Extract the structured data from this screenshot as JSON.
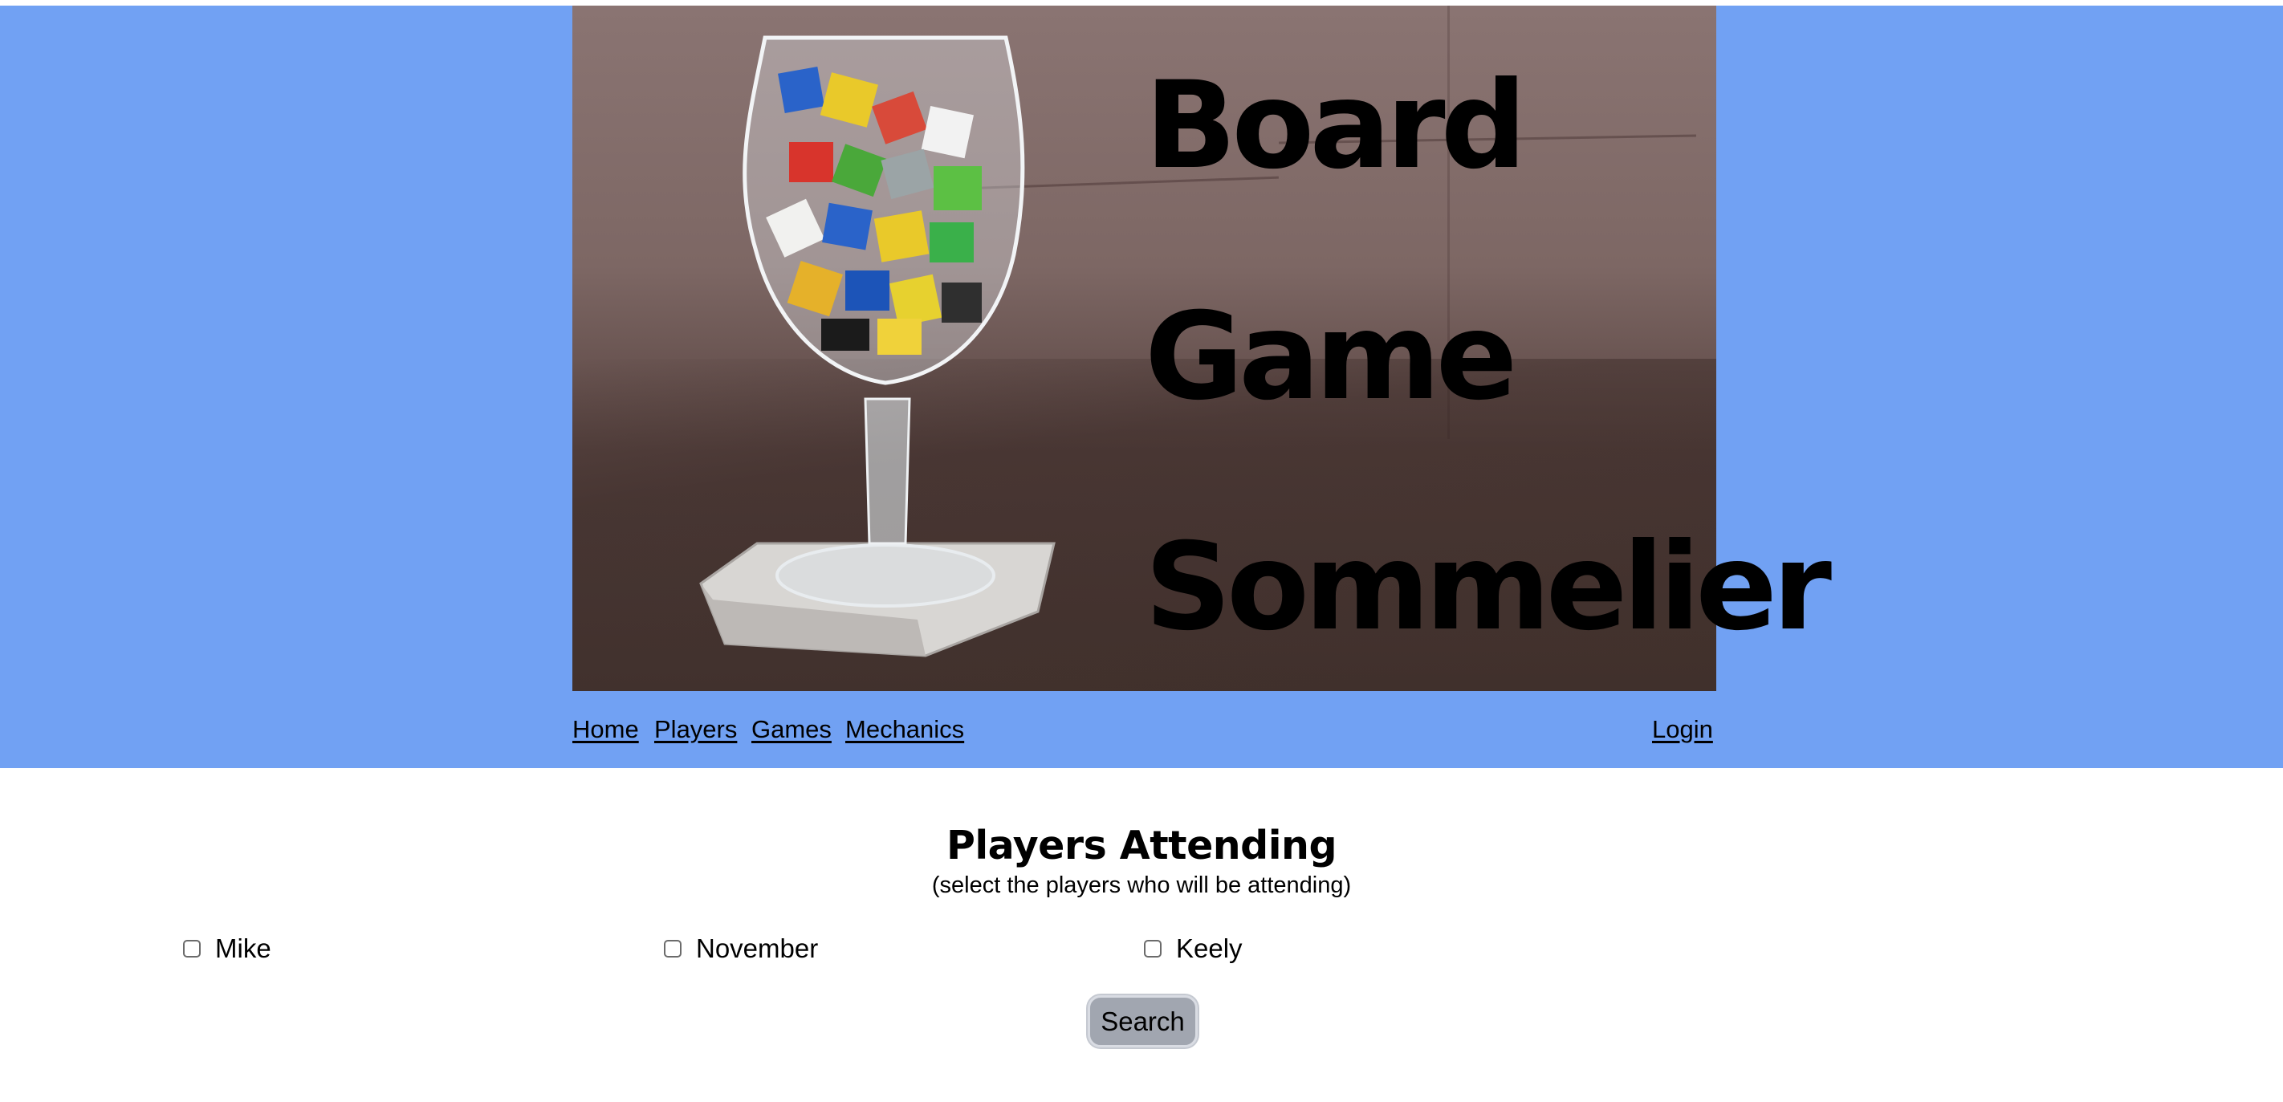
{
  "hero": {
    "title_lines": [
      "Board",
      "Game",
      "Sommelier"
    ]
  },
  "nav": {
    "links": [
      "Home",
      "Players",
      "Games",
      "Mechanics"
    ],
    "login": "Login"
  },
  "main": {
    "title": "Players Attending",
    "subtitle": "(select the players who will be attending)",
    "players": [
      {
        "name": "Mike",
        "checked": false
      },
      {
        "name": "November",
        "checked": false
      },
      {
        "name": "Keely",
        "checked": false
      }
    ],
    "search_label": "Search"
  },
  "colors": {
    "header_bg": "#71a1f3",
    "button_bg": "#a1a6b0"
  }
}
